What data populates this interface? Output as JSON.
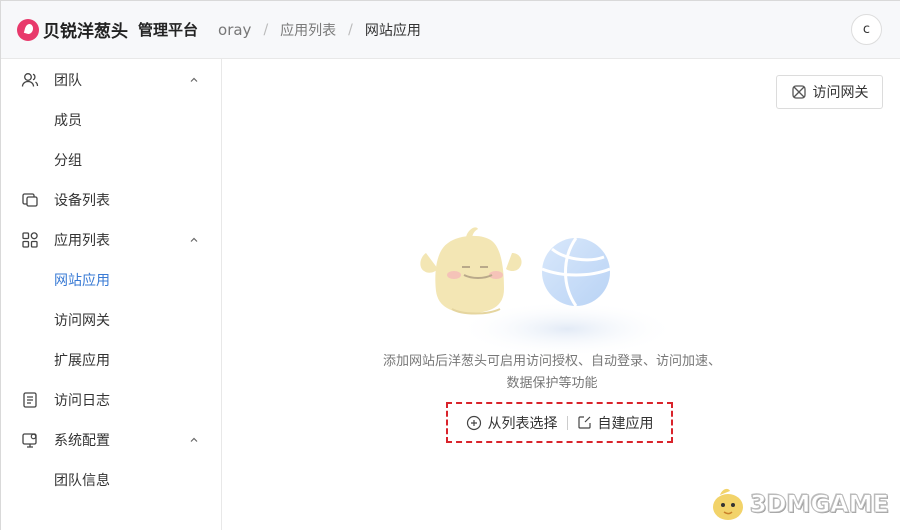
{
  "header": {
    "brand": "贝锐洋葱头",
    "platform": "管理平台",
    "breadcrumb": [
      "oray",
      "应用列表",
      "网站应用"
    ],
    "breadcrumb_separator": "/",
    "avatar_initial": "c"
  },
  "sidebar": {
    "items": [
      {
        "label": "团队",
        "icon": "team-icon",
        "expandable": true
      },
      {
        "label": "成员"
      },
      {
        "label": "分组"
      },
      {
        "label": "设备列表",
        "icon": "devices-icon"
      },
      {
        "label": "应用列表",
        "icon": "apps-icon",
        "expandable": true
      },
      {
        "label": "网站应用",
        "active": true
      },
      {
        "label": "访问网关"
      },
      {
        "label": "扩展应用"
      },
      {
        "label": "访问日志",
        "icon": "log-icon"
      },
      {
        "label": "系统配置",
        "icon": "settings-icon",
        "expandable": true
      },
      {
        "label": "团队信息"
      }
    ]
  },
  "main": {
    "gateway_button": "访问网关",
    "empty_text": "添加网站后洋葱头可启用访问授权、自动登录、访问加速、数据保护等功能",
    "action_select": "从列表选择",
    "action_create": "自建应用"
  },
  "watermark": "3DMGAME",
  "colors": {
    "brand": "#e8396b",
    "active": "#3a7bd5",
    "highlight_border": "#d9232b"
  }
}
